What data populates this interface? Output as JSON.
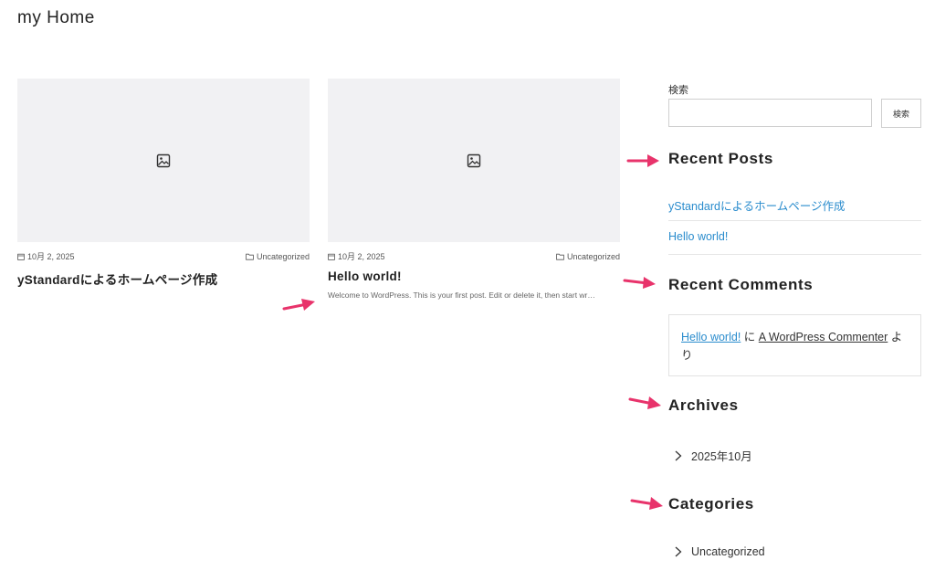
{
  "site": {
    "title": "my Home"
  },
  "posts": [
    {
      "date": "10月 2, 2025",
      "category": "Uncategorized",
      "title": "yStandardによるホームページ作成",
      "excerpt": ""
    },
    {
      "date": "10月 2, 2025",
      "category": "Uncategorized",
      "title": "Hello world!",
      "excerpt": "Welcome to WordPress. This is your first post. Edit or delete it, then start wr…"
    }
  ],
  "sidebar": {
    "search": {
      "label": "検索",
      "button": "検索",
      "value": ""
    },
    "recent_posts": {
      "title": "Recent Posts",
      "items": [
        "yStandardによるホームページ作成",
        "Hello world!"
      ]
    },
    "recent_comments": {
      "title": "Recent Comments",
      "post_link": "Hello world!",
      "connector": "に",
      "author": "A WordPress Commenter",
      "suffix": "より"
    },
    "archives": {
      "title": "Archives",
      "items": [
        "2025年10月"
      ]
    },
    "categories": {
      "title": "Categories",
      "items": [
        "Uncategorized"
      ]
    }
  },
  "colors": {
    "link": "#2a8ccd",
    "annotation_arrow": "#e8336b",
    "thumb_bg": "#f1f1f3"
  },
  "icons": [
    "image-placeholder-icon",
    "calendar-icon",
    "folder-icon",
    "chevron-right-icon",
    "annotation-arrow-icon"
  ]
}
